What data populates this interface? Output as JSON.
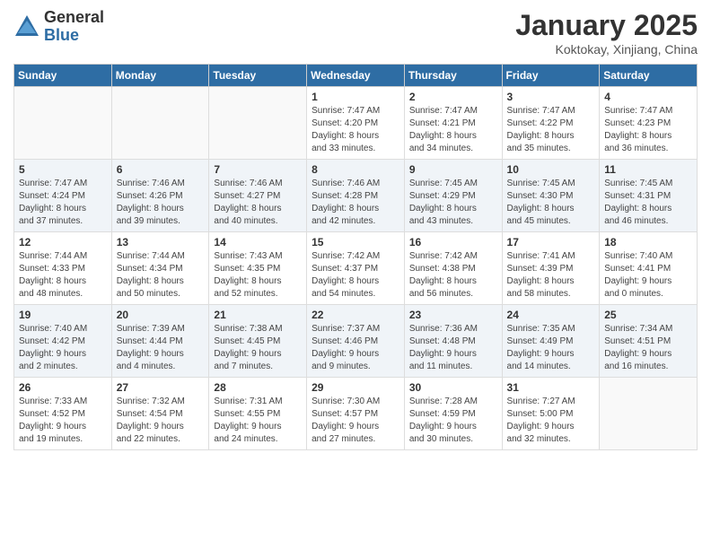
{
  "logo": {
    "general": "General",
    "blue": "Blue"
  },
  "header": {
    "month": "January 2025",
    "location": "Koktokay, Xinjiang, China"
  },
  "weekdays": [
    "Sunday",
    "Monday",
    "Tuesday",
    "Wednesday",
    "Thursday",
    "Friday",
    "Saturday"
  ],
  "weeks": [
    [
      {
        "num": "",
        "info": ""
      },
      {
        "num": "",
        "info": ""
      },
      {
        "num": "",
        "info": ""
      },
      {
        "num": "1",
        "info": "Sunrise: 7:47 AM\nSunset: 4:20 PM\nDaylight: 8 hours\nand 33 minutes."
      },
      {
        "num": "2",
        "info": "Sunrise: 7:47 AM\nSunset: 4:21 PM\nDaylight: 8 hours\nand 34 minutes."
      },
      {
        "num": "3",
        "info": "Sunrise: 7:47 AM\nSunset: 4:22 PM\nDaylight: 8 hours\nand 35 minutes."
      },
      {
        "num": "4",
        "info": "Sunrise: 7:47 AM\nSunset: 4:23 PM\nDaylight: 8 hours\nand 36 minutes."
      }
    ],
    [
      {
        "num": "5",
        "info": "Sunrise: 7:47 AM\nSunset: 4:24 PM\nDaylight: 8 hours\nand 37 minutes."
      },
      {
        "num": "6",
        "info": "Sunrise: 7:46 AM\nSunset: 4:26 PM\nDaylight: 8 hours\nand 39 minutes."
      },
      {
        "num": "7",
        "info": "Sunrise: 7:46 AM\nSunset: 4:27 PM\nDaylight: 8 hours\nand 40 minutes."
      },
      {
        "num": "8",
        "info": "Sunrise: 7:46 AM\nSunset: 4:28 PM\nDaylight: 8 hours\nand 42 minutes."
      },
      {
        "num": "9",
        "info": "Sunrise: 7:45 AM\nSunset: 4:29 PM\nDaylight: 8 hours\nand 43 minutes."
      },
      {
        "num": "10",
        "info": "Sunrise: 7:45 AM\nSunset: 4:30 PM\nDaylight: 8 hours\nand 45 minutes."
      },
      {
        "num": "11",
        "info": "Sunrise: 7:45 AM\nSunset: 4:31 PM\nDaylight: 8 hours\nand 46 minutes."
      }
    ],
    [
      {
        "num": "12",
        "info": "Sunrise: 7:44 AM\nSunset: 4:33 PM\nDaylight: 8 hours\nand 48 minutes."
      },
      {
        "num": "13",
        "info": "Sunrise: 7:44 AM\nSunset: 4:34 PM\nDaylight: 8 hours\nand 50 minutes."
      },
      {
        "num": "14",
        "info": "Sunrise: 7:43 AM\nSunset: 4:35 PM\nDaylight: 8 hours\nand 52 minutes."
      },
      {
        "num": "15",
        "info": "Sunrise: 7:42 AM\nSunset: 4:37 PM\nDaylight: 8 hours\nand 54 minutes."
      },
      {
        "num": "16",
        "info": "Sunrise: 7:42 AM\nSunset: 4:38 PM\nDaylight: 8 hours\nand 56 minutes."
      },
      {
        "num": "17",
        "info": "Sunrise: 7:41 AM\nSunset: 4:39 PM\nDaylight: 8 hours\nand 58 minutes."
      },
      {
        "num": "18",
        "info": "Sunrise: 7:40 AM\nSunset: 4:41 PM\nDaylight: 9 hours\nand 0 minutes."
      }
    ],
    [
      {
        "num": "19",
        "info": "Sunrise: 7:40 AM\nSunset: 4:42 PM\nDaylight: 9 hours\nand 2 minutes."
      },
      {
        "num": "20",
        "info": "Sunrise: 7:39 AM\nSunset: 4:44 PM\nDaylight: 9 hours\nand 4 minutes."
      },
      {
        "num": "21",
        "info": "Sunrise: 7:38 AM\nSunset: 4:45 PM\nDaylight: 9 hours\nand 7 minutes."
      },
      {
        "num": "22",
        "info": "Sunrise: 7:37 AM\nSunset: 4:46 PM\nDaylight: 9 hours\nand 9 minutes."
      },
      {
        "num": "23",
        "info": "Sunrise: 7:36 AM\nSunset: 4:48 PM\nDaylight: 9 hours\nand 11 minutes."
      },
      {
        "num": "24",
        "info": "Sunrise: 7:35 AM\nSunset: 4:49 PM\nDaylight: 9 hours\nand 14 minutes."
      },
      {
        "num": "25",
        "info": "Sunrise: 7:34 AM\nSunset: 4:51 PM\nDaylight: 9 hours\nand 16 minutes."
      }
    ],
    [
      {
        "num": "26",
        "info": "Sunrise: 7:33 AM\nSunset: 4:52 PM\nDaylight: 9 hours\nand 19 minutes."
      },
      {
        "num": "27",
        "info": "Sunrise: 7:32 AM\nSunset: 4:54 PM\nDaylight: 9 hours\nand 22 minutes."
      },
      {
        "num": "28",
        "info": "Sunrise: 7:31 AM\nSunset: 4:55 PM\nDaylight: 9 hours\nand 24 minutes."
      },
      {
        "num": "29",
        "info": "Sunrise: 7:30 AM\nSunset: 4:57 PM\nDaylight: 9 hours\nand 27 minutes."
      },
      {
        "num": "30",
        "info": "Sunrise: 7:28 AM\nSunset: 4:59 PM\nDaylight: 9 hours\nand 30 minutes."
      },
      {
        "num": "31",
        "info": "Sunrise: 7:27 AM\nSunset: 5:00 PM\nDaylight: 9 hours\nand 32 minutes."
      },
      {
        "num": "",
        "info": ""
      }
    ]
  ]
}
